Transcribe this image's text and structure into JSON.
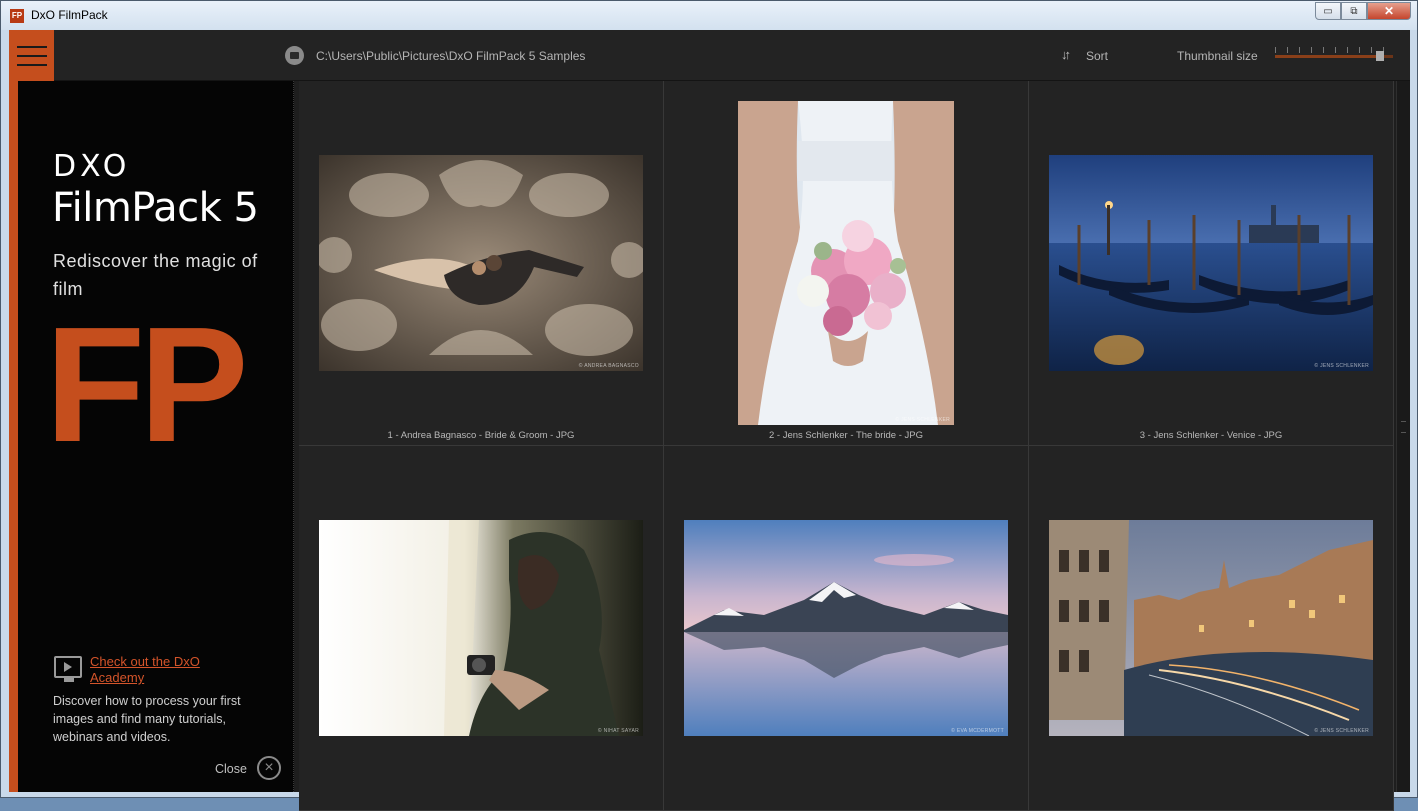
{
  "window": {
    "title": "DxO FilmPack",
    "app_icon_text": "FP",
    "controls": {
      "minimize": "▭",
      "restore": "⧉",
      "close": "✕"
    }
  },
  "toolbar": {
    "path": "C:\\Users\\Public\\Pictures\\DxO FilmPack 5 Samples",
    "sort_label": "Sort",
    "sort_icon": "↓↑",
    "thumbnail_size_label": "Thumbnail size",
    "thumbnail_size_level": 0.92
  },
  "sidebar": {
    "brand": "DXO",
    "product": "FilmPack 5",
    "tagline": "Rediscover the magic of film",
    "big_logo": "FP",
    "academy_link": "Check out the DxO Academy",
    "academy_desc": "Discover how to process your first images and find many tutorials, webinars and videos.",
    "close_label": "Close",
    "close_icon": "×"
  },
  "thumbnails": [
    {
      "caption": "1 - Andrea Bagnasco - Bride & Groom - JPG",
      "watermark": "© ANDREA BAGNASCO"
    },
    {
      "caption": "2 - Jens Schlenker - The bride - JPG",
      "watermark": "© JENS SCHLENKER"
    },
    {
      "caption": "3 - Jens Schlenker - Venice - JPG",
      "watermark": "© JENS SCHLENKER"
    },
    {
      "caption": "",
      "watermark": "© NIHAT SAYAR"
    },
    {
      "caption": "",
      "watermark": "© EVA MCDERMOTT"
    },
    {
      "caption": "",
      "watermark": "© JENS SCHLENKER"
    }
  ],
  "colors": {
    "accent": "#c54e1d",
    "background": "#1e1e1e",
    "sidebar": "#050505",
    "link": "#d4542a"
  }
}
